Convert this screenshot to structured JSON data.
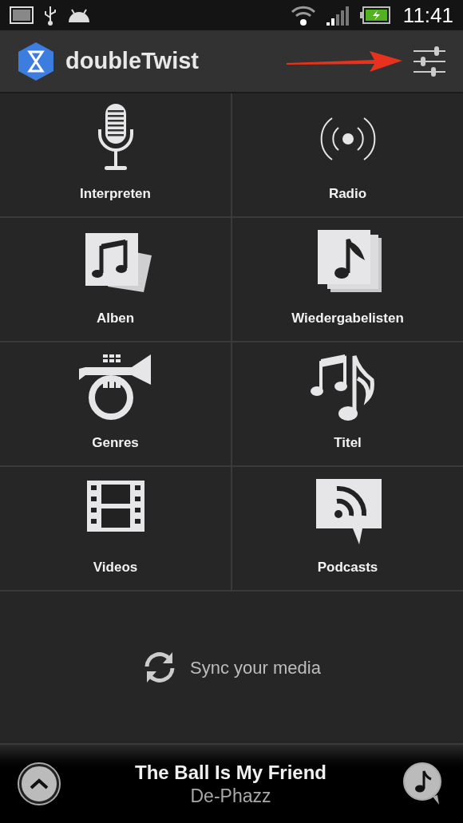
{
  "status_bar": {
    "time": "11:41"
  },
  "app_bar": {
    "title": "doubleTwist"
  },
  "library": [
    {
      "label": "Interpreten",
      "kind": "microphone"
    },
    {
      "label": "Radio",
      "kind": "radio"
    },
    {
      "label": "Alben",
      "kind": "albums"
    },
    {
      "label": "Wiedergabelisten",
      "kind": "playlists"
    },
    {
      "label": "Genres",
      "kind": "trumpet"
    },
    {
      "label": "Titel",
      "kind": "notes"
    },
    {
      "label": "Videos",
      "kind": "film"
    },
    {
      "label": "Podcasts",
      "kind": "podcast"
    }
  ],
  "sync": {
    "label": "Sync your media"
  },
  "now_playing": {
    "title": "The Ball Is My Friend",
    "artist": "De-Phazz"
  }
}
